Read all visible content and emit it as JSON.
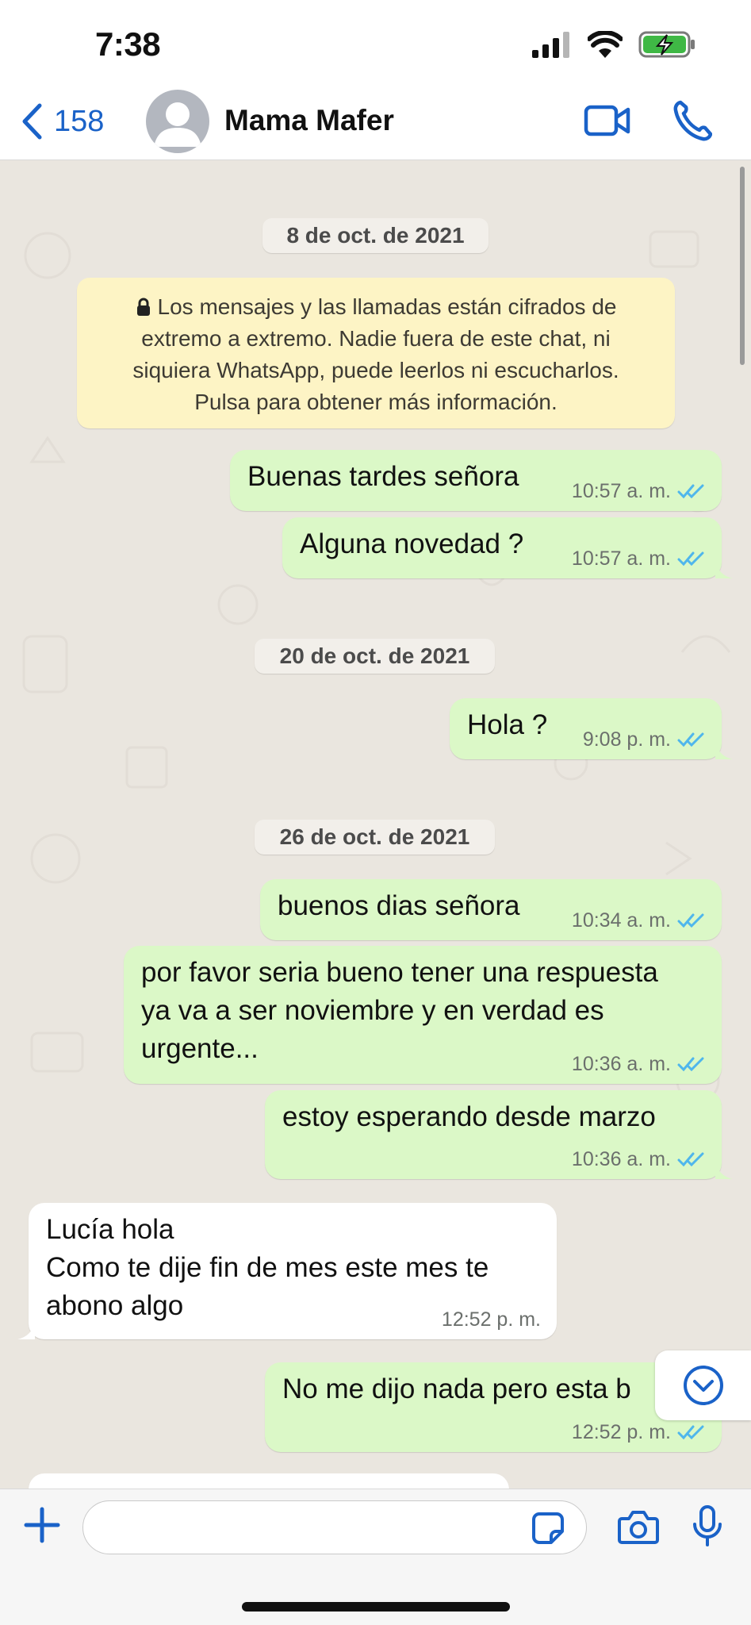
{
  "status_bar": {
    "time": "7:38",
    "icons": [
      "signal-icon",
      "wifi-icon",
      "battery-charging-icon"
    ]
  },
  "header": {
    "back_count": "158",
    "contact_name": "Mama Mafer",
    "icons": [
      "chevron-left-icon",
      "avatar-placeholder-icon",
      "video-call-icon",
      "phone-icon"
    ]
  },
  "chat": {
    "dates": {
      "d1": "8 de oct. de 2021",
      "d2": "20 de oct. de 2021",
      "d3": "26 de oct. de 2021"
    },
    "encryption": {
      "line1": "Los mensajes y las llamadas están cifrados de",
      "line2": "extremo a extremo. Nadie fuera de este chat, ni",
      "line3": "siquiera WhatsApp, puede leerlos ni escucharlos.",
      "line4": "Pulsa para obtener más información."
    },
    "messages": [
      {
        "direction": "out",
        "text": "Buenas tardes señora",
        "time": "10:57 a. m.",
        "status": "read"
      },
      {
        "direction": "out",
        "text": "Alguna novedad ?",
        "time": "10:57 a. m.",
        "status": "read"
      },
      {
        "direction": "out",
        "text": "Hola ?",
        "time": "9:08 p. m.",
        "status": "read"
      },
      {
        "direction": "out",
        "text": "buenos dias señora",
        "time": "10:34 a. m.",
        "status": "read"
      },
      {
        "direction": "out",
        "text": "por favor seria bueno tener una respuesta\nya va a ser noviembre y en verdad es\nurgente...",
        "time": "10:36 a. m.",
        "status": "read"
      },
      {
        "direction": "out",
        "text": "estoy esperando desde marzo",
        "time": "10:36 a. m.",
        "status": "read"
      },
      {
        "direction": "in",
        "text": "Lucía hola\nComo te dije fin de mes este mes te\nabono algo",
        "time": "12:52 p. m."
      },
      {
        "direction": "out",
        "text": "No me dijo nada pero esta b",
        "time": "12:52 p. m.",
        "status": "read"
      }
    ]
  },
  "input": {
    "placeholder": "",
    "icons": [
      "plus-icon",
      "sticker-icon",
      "camera-icon",
      "microphone-icon"
    ]
  },
  "colors": {
    "accent": "#1a62c8",
    "outgoing_bubble": "#dbf8c7",
    "incoming_bubble": "#ffffff",
    "chat_background": "#eae6df",
    "encryption_notice": "#fdf4c5",
    "read_ticks": "#4fb6ec"
  }
}
